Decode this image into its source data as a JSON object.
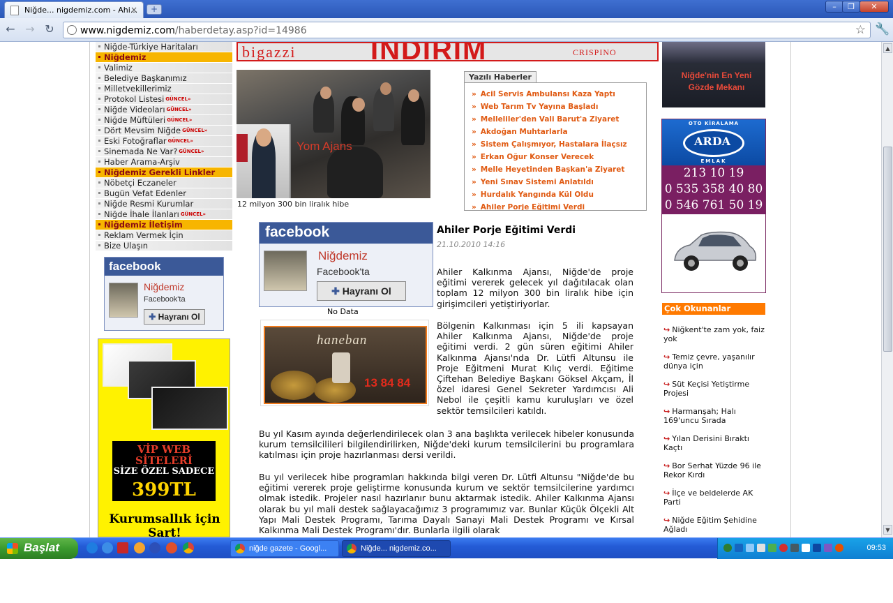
{
  "browser": {
    "tab_title": "Niğde... nigdemiz.com - Ahi...",
    "tab_close": "×",
    "new_tab": "+",
    "url_host": "www.nigdemiz.com",
    "url_path": "/haberdetay.asp?id=14986"
  },
  "left_menu": {
    "items": [
      {
        "label": "Niğde-Türkiye Haritaları",
        "head": false,
        "badge": ""
      },
      {
        "label": "Niğdemiz",
        "head": true,
        "badge": ""
      },
      {
        "label": "Valimiz",
        "head": false,
        "badge": ""
      },
      {
        "label": "Belediye Başkanımız",
        "head": false,
        "badge": ""
      },
      {
        "label": "Milletvekillerimiz",
        "head": false,
        "badge": ""
      },
      {
        "label": "Protokol Listesi",
        "head": false,
        "badge": "GÜNCEL»"
      },
      {
        "label": "Niğde Videoları",
        "head": false,
        "badge": "GÜNCEL»"
      },
      {
        "label": "Niğde Müftüleri",
        "head": false,
        "badge": "GÜNCEL»"
      },
      {
        "label": "Dört Mevsim Niğde",
        "head": false,
        "badge": "GÜNCEL»"
      },
      {
        "label": "Eski Fotoğraflar",
        "head": false,
        "badge": "GÜNCEL»"
      },
      {
        "label": "Sinemada Ne Var?",
        "head": false,
        "badge": "GÜNCEL»"
      },
      {
        "label": "Haber Arama-Arşiv",
        "head": false,
        "badge": ""
      },
      {
        "label": "Niğdemiz Gerekli Linkler",
        "head": true,
        "badge": ""
      },
      {
        "label": "Nöbetçi Eczaneler",
        "head": false,
        "badge": ""
      },
      {
        "label": "Bugün Vefat Edenler",
        "head": false,
        "badge": ""
      },
      {
        "label": "Niğde Resmi Kurumlar",
        "head": false,
        "badge": ""
      },
      {
        "label": "Niğde İhale İlanları",
        "head": false,
        "badge": "GÜNCEL»"
      },
      {
        "label": "Niğdemiz İletişim",
        "head": true,
        "badge": ""
      },
      {
        "label": "Reklam Vermek İçin",
        "head": false,
        "badge": ""
      },
      {
        "label": "Bize Ulaşın",
        "head": false,
        "badge": ""
      }
    ]
  },
  "facebook": {
    "brand": "facebook",
    "page_name": "Niğdemiz",
    "sub": "Facebook'ta",
    "button": "Hayranı Ol",
    "no_data": "No Data"
  },
  "vip_ad": {
    "line1": "VİP WEB SİTELERİ",
    "line2": "SİZE ÖZEL SADECE",
    "price": "399TL",
    "footer": "Kurumsallık için Şart!"
  },
  "banner": {
    "left": "bigazzi",
    "mid": "İNDİRİM",
    "right": "CRISPINO"
  },
  "photo": {
    "tag": "Yom Ajans",
    "caption": "12 milyon 300 bin liralık hibe"
  },
  "yazili": {
    "title": "Yazılı Haberler",
    "items": [
      "Acil Servis Ambulansı Kaza Yaptı",
      "Web Tarım Tv Yayına Başladı",
      "Melleliler'den Vali Barut'a Ziyaret",
      "Akdoğan Muhtarlarla",
      "Sistem Çalışmıyor, Hastalara İlaçsız",
      "Erkan Oğur Konser Verecek",
      "Melle Heyetinden Başkan'a Ziyaret",
      "Yeni Sınav Sistemi Anlatıldı",
      "Hurdalık Yangında Kül Oldu",
      "Ahiler Porje Eğitimi Verdi"
    ]
  },
  "article": {
    "title": "Ahiler Porje Eğitimi Verdi",
    "date": "21.10.2010    14:16",
    "p1": "Ahiler Kalkınma Ajansı, Niğde'de proje eğitimi vererek gelecek yıl dağıtılacak olan toplam 12 milyon 300 bin liralık hibe için girişimcileri yetiştiriyorlar.",
    "p2": "Bölgenin Kalkınması için 5 ili kapsayan Ahiler Kalkınma Ajansı, Niğde'de proje eğitimi verdi. 2 gün süren eğitimi Ahiler Kalkınma Ajansı'nda Dr. Lütfi Altunsu ile Proje Eğitmeni Murat Kılıç verdi. Eğitime Çiftehan Belediye Başkanı Göksel Akçam, İl özel idaresi Genel Sekreter Yardımcısı Ali Nebol ile çeşitli kamu kuruluşları ve özel sektör temsilcileri katıldı.",
    "p3": "Bu yıl Kasım ayında değerlendirilecek olan 3 ana başlıkta verilecek hibeler konusunda kurum temsilcilileri bilgilendirilirken, Niğde'deki kurum temsilcilerini bu programlara katılması için proje hazırlanması dersi verildi.",
    "p4": "Bu yıl verilecek hibe programları hakkında bilgi veren Dr. Lütfi Altunsu \"Niğde'de bu eğitimi vererek proje geliştirme konusunda kurum ve sektör temsilcilerine yardımcı olmak istedik. Projeler nasıl hazırlanır bunu aktarmak istedik. Ahiler Kalkınma Ajansı olarak bu yıl mali destek sağlayacağımız 3 programımız var. Bunlar Küçük Ölçekli Alt Yapı Mali Destek Programı, Tarıma Dayalı Sanayi Mali Destek Programı ve Kırsal Kalkınma Mali Destek Programı'dır. Bunlarla ilgili olarak"
  },
  "haneban": {
    "logo": "haneban",
    "phone": "13 84 84"
  },
  "right_top": {
    "text": "Niğde'nin En Yeni Gözde Mekanı"
  },
  "arda": {
    "ribbon": "OTO KİRALAMA",
    "name": "ARDA",
    "sub": "EMLAK",
    "phone1": "213 10 19",
    "phone2": "0 535 358 40 80",
    "phone3": "0 546 761 50 19"
  },
  "cok_okunanlar": {
    "title": "Çok Okunanlar",
    "items": [
      "Niğkent'te zam yok, faiz yok",
      "Temiz çevre, yaşanılır dünya için",
      "Süt Keçisi Yetiştirme Projesi",
      "Harmanşah; Halı 169'uncu Sırada",
      "Yılan Derisini Bıraktı Kaçtı",
      "Bor Serhat Yüzde 96 ile Rekor Kırdı",
      "İlçe ve beldelerde AK Parti",
      "Niğde Eğitim Şehidine Ağladı"
    ]
  },
  "taskbar": {
    "start": "Başlat",
    "task1": "niğde gazete - Googl...",
    "task2": "Niğde... nigdemiz.co...",
    "clock": "09:53"
  }
}
